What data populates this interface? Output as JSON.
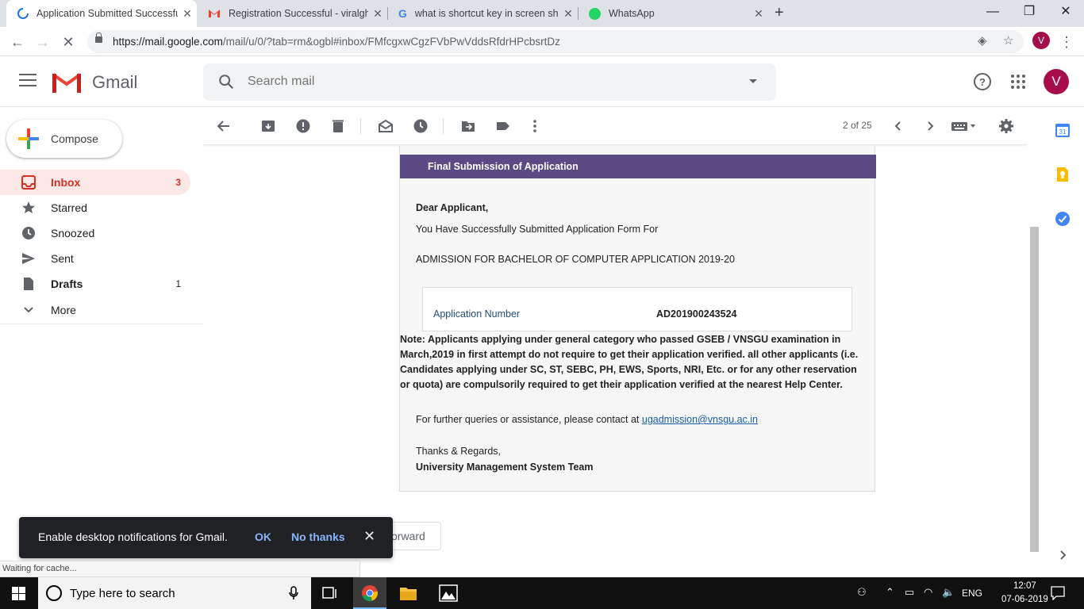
{
  "browser": {
    "tabs": [
      {
        "title": "Application Submitted Successfu",
        "icon": "loading-spinner-icon"
      },
      {
        "title": "Registration Successful - viralghc",
        "icon": "gmail-icon"
      },
      {
        "title": "what is shortcut key in screen sho",
        "icon": "google-icon"
      },
      {
        "title": "WhatsApp",
        "icon": "whatsapp-icon"
      }
    ],
    "url_host": "https://mail.google.com",
    "url_path": "/mail/u/0/?tab=rm&ogbl#inbox/FMfcgxwCgzFVbPwVddsRfdrHPcbsrtDz",
    "profile_initial": "V"
  },
  "gmail": {
    "app_name": "Gmail",
    "search_placeholder": "Search mail",
    "account_initial": "V",
    "compose_label": "Compose",
    "nav": [
      {
        "label": "Inbox",
        "count": "3",
        "icon": "inbox-icon"
      },
      {
        "label": "Starred",
        "count": "",
        "icon": "star-icon"
      },
      {
        "label": "Snoozed",
        "count": "",
        "icon": "clock-icon"
      },
      {
        "label": "Sent",
        "count": "",
        "icon": "send-icon"
      },
      {
        "label": "Drafts",
        "count": "1",
        "icon": "draft-icon"
      },
      {
        "label": "More",
        "count": "",
        "icon": "chevron-down-icon"
      }
    ],
    "pagination": "2 of 25"
  },
  "email": {
    "banner": "Final Submission of Application",
    "greeting": "Dear Applicant,",
    "line1": "You Have Successfully Submitted Application Form For",
    "course": "ADMISSION FOR BACHELOR OF COMPUTER APPLICATION 2019-20",
    "app_number_label": "Application Number",
    "app_number_value": "AD201900243524",
    "note": "Note: Applicants applying under general category who passed GSEB / VNSGU examination in March,2019 in first attempt do not require to get their application verified. all other applicants (i.e. Candidates applying under SC, ST, SEBC, PH, EWS, Sports, NRI, Etc. or for any other reservation or quota) are compulsorily required to get their application verified at the nearest Help Center.",
    "queries_text": "For further queries or assistance, please contact at ",
    "contact_email": "ugadmission@vnsgu.ac.in",
    "thanks": "Thanks & Regards,",
    "team": "University Management System Team",
    "forward_label": "orward"
  },
  "toast": {
    "message": "Enable desktop notifications for Gmail.",
    "ok": "OK",
    "no_thanks": "No thanks"
  },
  "status": "Waiting for cache...",
  "taskbar": {
    "search_placeholder": "Type here to search",
    "lang": "ENG",
    "time": "12:07",
    "date": "07-06-2019"
  },
  "colors": {
    "banner": "#5b4b85",
    "accent_red": "#d93025",
    "avatar": "#a50e4a"
  }
}
